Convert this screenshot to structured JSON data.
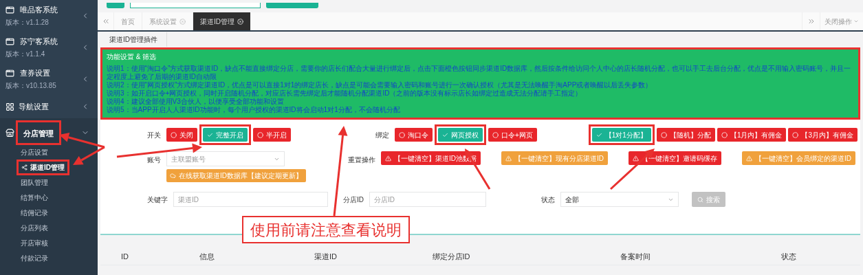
{
  "sidebar": {
    "items": [
      {
        "kind": "system",
        "label": "唯品客系统",
        "version": "版本：v1.1.28",
        "expanded": false
      },
      {
        "kind": "system",
        "label": "苏宁客系统",
        "version": "版本：v1.1.4",
        "expanded": false
      },
      {
        "kind": "system",
        "label": "查券设置",
        "version": "版本：v10.13.85",
        "expanded": false
      },
      {
        "kind": "menu",
        "label": "导航设置",
        "expanded": false
      },
      {
        "kind": "menu",
        "label": "分店管理",
        "expanded": true,
        "children": [
          {
            "label": "分店设置",
            "selected": false
          },
          {
            "label": "渠道ID管理",
            "selected": true
          },
          {
            "label": "团队管理",
            "selected": false
          },
          {
            "label": "结算中心",
            "selected": false
          },
          {
            "label": "结佣记录",
            "selected": false
          },
          {
            "label": "分店列表",
            "selected": false
          },
          {
            "label": "开店审核",
            "selected": false
          },
          {
            "label": "付款记录",
            "selected": false
          }
        ]
      }
    ]
  },
  "tabs": [
    {
      "label": "首页",
      "selected": false,
      "closable": false
    },
    {
      "label": "系统设置",
      "selected": false,
      "closable": true
    },
    {
      "label": "渠道ID管理",
      "selected": true,
      "closable": true
    }
  ],
  "tab_actions": {
    "close_menu": "关闭操作"
  },
  "panel_tab": "渠道ID管理插件",
  "notice": {
    "title": "功能设置 & 筛选",
    "lines": [
      "说明1：使用“淘口令”方式获取渠道ID，缺点不能直接绑定分店，需要你的店长们配合大量进行绑定后，点击下面橙色按钮同步渠道ID数据库，然后按条件给访问个人中心的店长随机分配，也可以手工去后台分配，优点是不用输入密码账号，并且一定程度上避免了后期的渠道ID自动限",
      "说明2：使用“网页授权”方式绑定渠道ID，优点是可以直接1对1的绑定店长，缺点是可能会需要输入密码和账号进行一次确认授权（尤其是无法唤醒手淘APP或者唤醒以后丢失参数）",
      "说明3：如开启口令+网页授权，同时开启随机分配，对应店长需先绑定后才能随机分配渠道ID（之前的版本没有标示店长如绑定过造成无法分配请手工指定）",
      "说明4：建议全部使用V3合伙人，以便享受全部功能和设置",
      "说明5：当APP开启人人渠道ID功能时，每个用户授权的渠道ID将会启动1对1分配，不会随机分配"
    ]
  },
  "switch_group": {
    "label": "开关",
    "options": [
      {
        "label": "关闭",
        "selected": false
      },
      {
        "label": "完整开启",
        "selected": true
      },
      {
        "label": "半开启",
        "selected": false
      }
    ]
  },
  "bind_group": {
    "label": "绑定",
    "options": [
      {
        "label": "淘口令",
        "selected": false
      },
      {
        "label": "网页授权",
        "selected": true
      },
      {
        "label": "口令+网页",
        "selected": false
      }
    ]
  },
  "allocation_group": {
    "options": [
      {
        "label": "【1对1分配】",
        "selected": true
      },
      {
        "label": "【随机】分配",
        "selected": false
      },
      {
        "label": "【1月内】有佣金",
        "selected": false
      },
      {
        "label": "【3月内】有佣金",
        "selected": false
      }
    ]
  },
  "account": {
    "label": "账号",
    "placeholder": "主联盟账号",
    "fetch_button": "在线获取渠道ID数据库【建议定期更新】"
  },
  "reset": {
    "label": "重置操作",
    "buttons": [
      {
        "label": "【一键清空】渠道ID池数据",
        "color": "#e8262b"
      },
      {
        "label": "【一键清空】现有分店渠道ID",
        "color": "#f0a13c"
      },
      {
        "label": "【一键清空】邀请码缓存",
        "color": "#e8262b"
      },
      {
        "label": "【一键清空】会员绑定的渠道ID",
        "color": "#f0a13c"
      }
    ]
  },
  "filters": {
    "keyword": {
      "label": "关键字",
      "placeholder": "渠道ID"
    },
    "store_id": {
      "label": "分店ID",
      "placeholder": "分店ID"
    },
    "status": {
      "label": "状态",
      "value": "全部"
    },
    "search_button": {
      "label": "搜索",
      "disabled": true
    }
  },
  "callout": "使用前请注意查看说明",
  "table": {
    "columns": [
      "ID",
      "信息",
      "渠道ID",
      "绑定分店ID",
      "备案时间",
      "状态"
    ]
  }
}
